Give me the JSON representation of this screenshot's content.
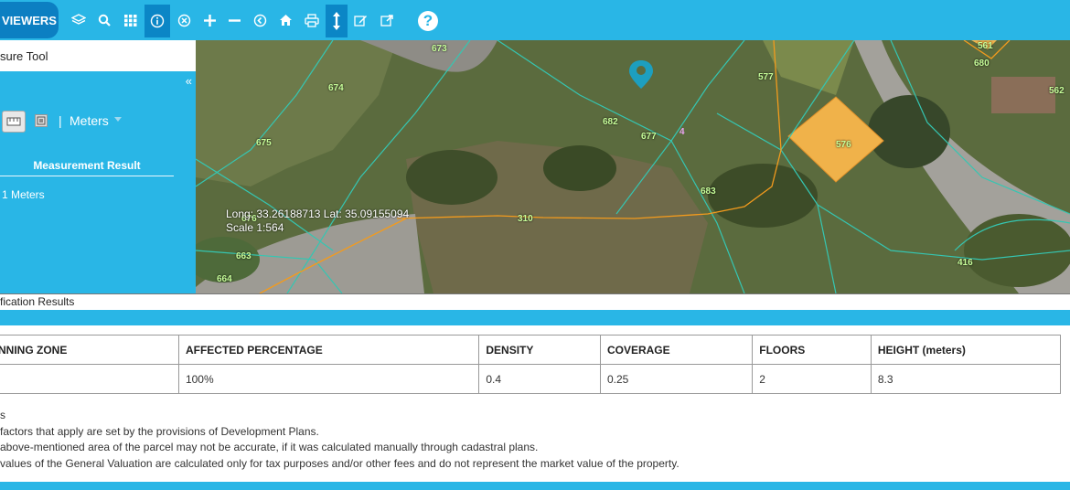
{
  "toolbar": {
    "viewers_label": "VIEWERS",
    "icons": [
      "layers-icon",
      "search-icon",
      "grid-icon",
      "info-icon",
      "clear-icon",
      "zoom-in-icon",
      "zoom-out-icon",
      "back-icon",
      "home-icon",
      "print-icon",
      "measure-icon",
      "edit-icon",
      "export-icon",
      "help-icon"
    ],
    "help_label": "?"
  },
  "panel": {
    "title": "sure Tool",
    "collapse": "«",
    "unit": "Meters",
    "unit_separator": "|",
    "result_heading": "Measurement Result",
    "result_value": "1 Meters"
  },
  "map": {
    "coordinates": "Long: 33.26188713 Lat: 35.09155094",
    "scale": "Scale 1:564",
    "parcels": [
      "673",
      "674",
      "675",
      "682",
      "677",
      "4",
      "577",
      "561",
      "680",
      "562",
      "576",
      "683",
      "310",
      "663",
      "664",
      "416",
      "676"
    ]
  },
  "results": {
    "title": "fication Results",
    "columns": [
      "NNING ZONE",
      "AFFECTED PERCENTAGE",
      "DENSITY",
      "COVERAGE",
      "FLOORS",
      "HEIGHT (meters)"
    ],
    "rows": [
      [
        "",
        "100%",
        "0.4",
        "0.25",
        "2",
        "8.3"
      ]
    ]
  },
  "notes": {
    "marker": "s",
    "lines": [
      "factors that apply are set by the provisions of Development Plans.",
      "above-mentioned area of the parcel may not be accurate, if it was calculated manually through cadastral plans.",
      "values of the General Valuation are calculated only for tax purposes and/or other fees and do not represent the market value of the property."
    ]
  },
  "colors": {
    "accent": "#29b6e6",
    "dark_accent": "#0c7fc2",
    "parcel_line": "#35c6b2",
    "road_line": "#f39b1d",
    "building": "#f5b342"
  }
}
